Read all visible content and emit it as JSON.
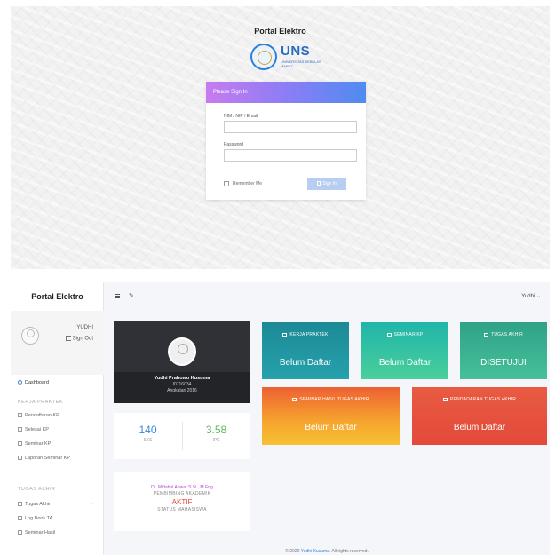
{
  "login": {
    "title": "Portal Elektro",
    "logo_word": "UNS",
    "logo_sub": "UNIVERSITAS SEBELAS MARET",
    "header": "Please Sign In",
    "id_label": "NIM / NIP / Email",
    "id_value": "",
    "password_label": "Password",
    "password_value": "",
    "remember_label": "Remember Me",
    "signin_label": "Sign In"
  },
  "dashboard": {
    "brand": "Portal Elektro",
    "user": {
      "name": "YUDHI",
      "signout": "Sign Out"
    },
    "nav": {
      "dashboard": "Dashboard",
      "header_kp": "KERJA PRAKTEK",
      "kp_items": [
        "Pendaftaran KP",
        "Selesai KP",
        "Seminar KP",
        "Laporan Seminar KP"
      ],
      "header_ta": "TUGAS AKHIR",
      "ta_items": [
        "Tugas Akhir",
        "Log Book TA",
        "Seminar Hasil"
      ]
    },
    "topbar_user": "Yudhi ⌄",
    "profile": {
      "name": "Yudhi Prabowo Kusuma",
      "nim": "I0716034",
      "year": "Angkatan 2016"
    },
    "stats": {
      "sks": "140",
      "sks_label": "SKS",
      "ipk": "3.58",
      "ipk_label": "IPK"
    },
    "advisor": {
      "name": "Dr. Miftahul Anwar S.Si., M.Eng",
      "role": "PEMBIMBING AKADEMIK",
      "status": "AKTIF",
      "status_label": "STATUS MAHASISWA"
    },
    "tiles": {
      "kp": {
        "title": "KERJA PRAKTEK",
        "status": "Belum Daftar"
      },
      "seminar_kp": {
        "title": "SEMINAR KP",
        "status": "Belum Daftar"
      },
      "ta": {
        "title": "TUGAS AKHIR",
        "status": "DISETUJUI"
      },
      "seminar_hasil_ta": {
        "title": "SEMINAR HASIL TUGAS AKHIR",
        "status": "Belum Daftar"
      },
      "pendadaran_ta": {
        "title": "PENDADARAN TUGAS AKHIR",
        "status": "Belum Daftar"
      }
    },
    "footer": {
      "prefix": "© 2020 ",
      "link": "Yudhi Kusuma",
      "suffix": ". All rights reserved."
    }
  },
  "icons": {
    "menu": "hamburger-icon",
    "tools": "wrench-icon",
    "avatar": "user-icon",
    "signout": "sign-out-icon"
  },
  "colors": {
    "login_header_gradient": [
      "#c77bf0",
      "#4f8cf0"
    ],
    "tile_kp": "#1c8a96",
    "tile_seminar_kp": "#3cc4a3",
    "tile_ta": "#3cb393",
    "tile_seminar_hasil": "#f28a31",
    "tile_pendadaran": "#e4503e",
    "link": "#3a87d6"
  }
}
